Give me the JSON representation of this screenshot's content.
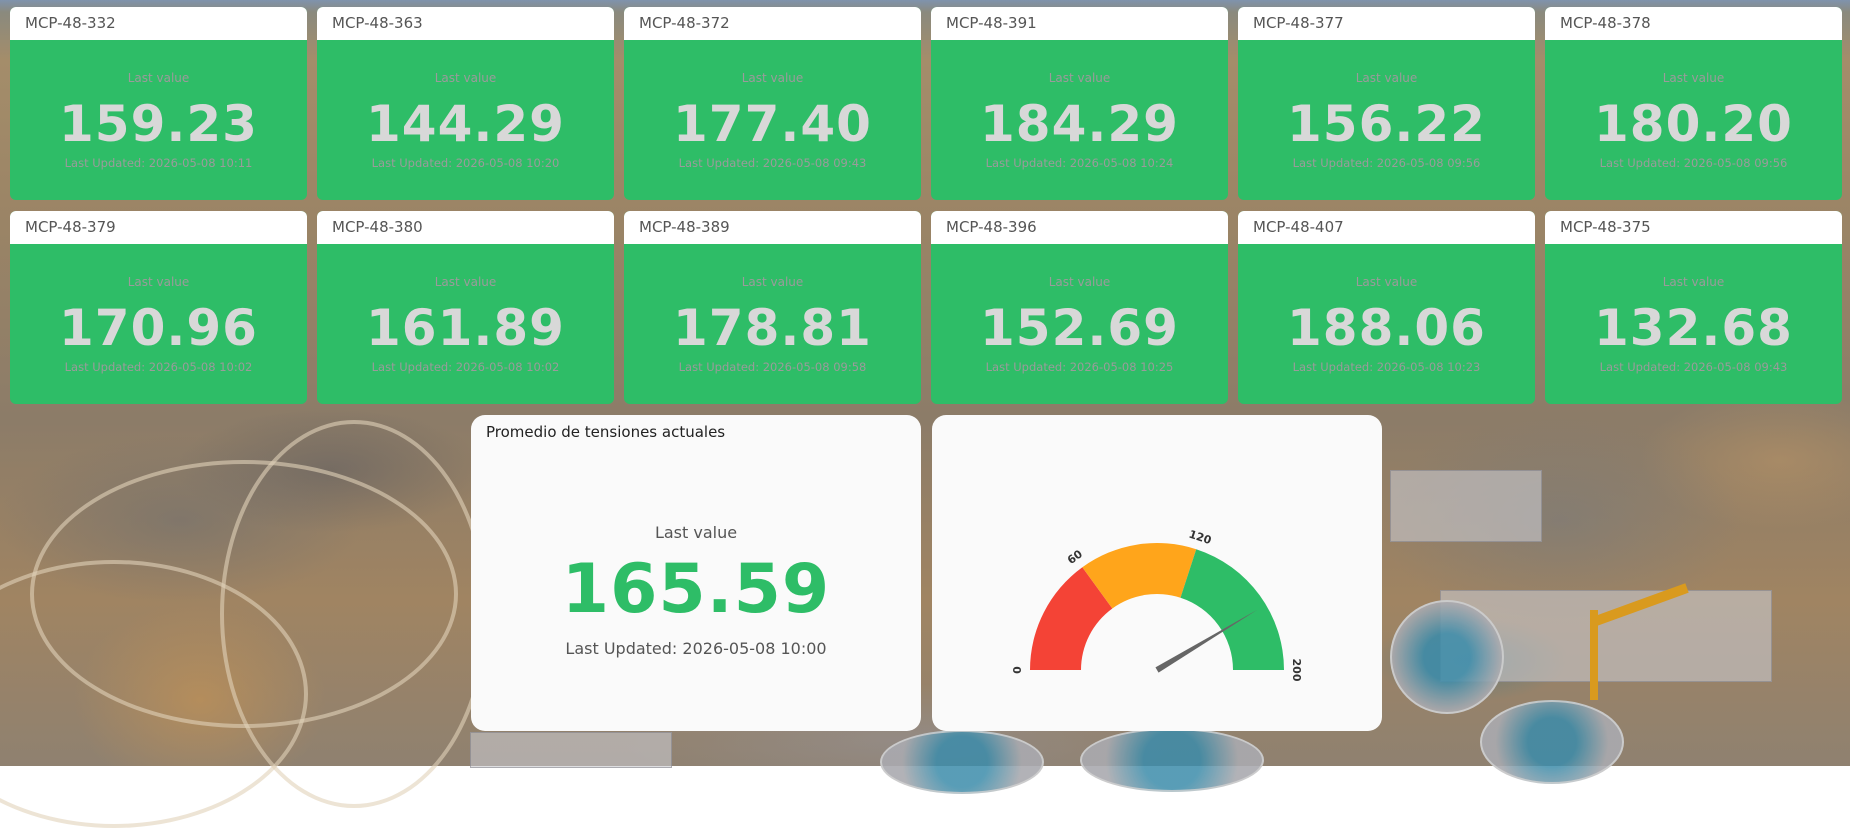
{
  "tiles": [
    {
      "title": "MCP-48-332",
      "caption": "Last value",
      "value": "159.23",
      "updated": "Last Updated: 2026-05-08 10:11"
    },
    {
      "title": "MCP-48-363",
      "caption": "Last value",
      "value": "144.29",
      "updated": "Last Updated: 2026-05-08 10:20"
    },
    {
      "title": "MCP-48-372",
      "caption": "Last value",
      "value": "177.40",
      "updated": "Last Updated: 2026-05-08 09:43"
    },
    {
      "title": "MCP-48-391",
      "caption": "Last value",
      "value": "184.29",
      "updated": "Last Updated: 2026-05-08 10:24"
    },
    {
      "title": "MCP-48-377",
      "caption": "Last value",
      "value": "156.22",
      "updated": "Last Updated: 2026-05-08 09:56"
    },
    {
      "title": "MCP-48-378",
      "caption": "Last value",
      "value": "180.20",
      "updated": "Last Updated: 2026-05-08 09:56"
    },
    {
      "title": "MCP-48-379",
      "caption": "Last value",
      "value": "170.96",
      "updated": "Last Updated: 2026-05-08 10:02"
    },
    {
      "title": "MCP-48-380",
      "caption": "Last value",
      "value": "161.89",
      "updated": "Last Updated: 2026-05-08 10:02"
    },
    {
      "title": "MCP-48-389",
      "caption": "Last value",
      "value": "178.81",
      "updated": "Last Updated: 2026-05-08 09:58"
    },
    {
      "title": "MCP-48-396",
      "caption": "Last value",
      "value": "152.69",
      "updated": "Last Updated: 2026-05-08 10:25"
    },
    {
      "title": "MCP-48-407",
      "caption": "Last value",
      "value": "188.06",
      "updated": "Last Updated: 2026-05-08 10:23"
    },
    {
      "title": "MCP-48-375",
      "caption": "Last value",
      "value": "132.68",
      "updated": "Last Updated: 2026-05-08 09:43"
    }
  ],
  "average_panel": {
    "title": "Promedio de tensiones actuales",
    "caption": "Last value",
    "value": "165.59",
    "updated": "Last Updated: 2026-05-08 10:00"
  },
  "gauge": {
    "min": 0,
    "max": 200,
    "value": 165.59,
    "bands": [
      {
        "from": 0,
        "to": 60,
        "color": "#f44336"
      },
      {
        "from": 60,
        "to": 120,
        "color": "#ffa51b"
      },
      {
        "from": 120,
        "to": 200,
        "color": "#2ebd67"
      }
    ],
    "tick_labels": [
      "0",
      "60",
      "120",
      "200"
    ]
  },
  "colors": {
    "tile_green": "#2ebd67",
    "tile_value": "#d8d8d8",
    "panel_bg": "#fafafa",
    "needle": "#666666"
  }
}
